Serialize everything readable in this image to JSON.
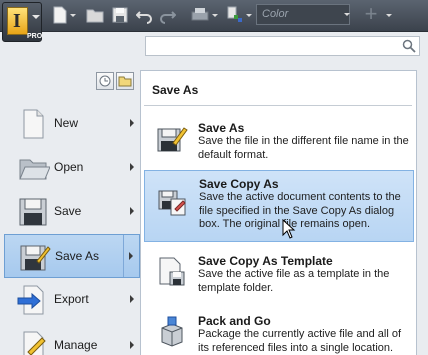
{
  "toolbar": {
    "app_logo_letter": "I",
    "app_edition": "PRO",
    "color_placeholder": "Color",
    "icons": [
      "new-icon",
      "open-icon",
      "save-icon",
      "undo-icon",
      "redo-icon",
      "print-icon",
      "properties-icon",
      "add-icon"
    ]
  },
  "search": {
    "placeholder": "",
    "icon": "search-icon"
  },
  "left_menu": {
    "items": [
      {
        "label": "New",
        "icon": "new-document-icon"
      },
      {
        "label": "Open",
        "icon": "open-folder-icon"
      },
      {
        "label": "Save",
        "icon": "floppy-disk-icon"
      },
      {
        "label": "Save As",
        "icon": "save-as-icon"
      },
      {
        "label": "Export",
        "icon": "export-icon"
      },
      {
        "label": "Manage",
        "icon": "manage-icon"
      }
    ],
    "active": "Save As"
  },
  "save_as_menu": {
    "title": "Save As",
    "entries": [
      {
        "title": "Save As",
        "description": "Save the file in the different file name in the default format.",
        "icon": "save-as-icon"
      },
      {
        "title": "Save Copy As",
        "description": "Save the active document contents to the file specified in the Save Copy As dialog box. The original file remains open.",
        "icon": "save-copy-icon"
      },
      {
        "title": "Save Copy As Template",
        "description": "Save the active file as a template in the template folder.",
        "icon": "template-icon"
      },
      {
        "title": "Pack and Go",
        "description": "Package the currently active file and all of its referenced files into a single location.",
        "icon": "pack-and-go-icon"
      }
    ],
    "hovered": "Save Copy As"
  },
  "colors": {
    "toolbar_bg": "#3b424c",
    "hover_bg": "#b8d5f3",
    "active_border": "#6e9fd3"
  }
}
